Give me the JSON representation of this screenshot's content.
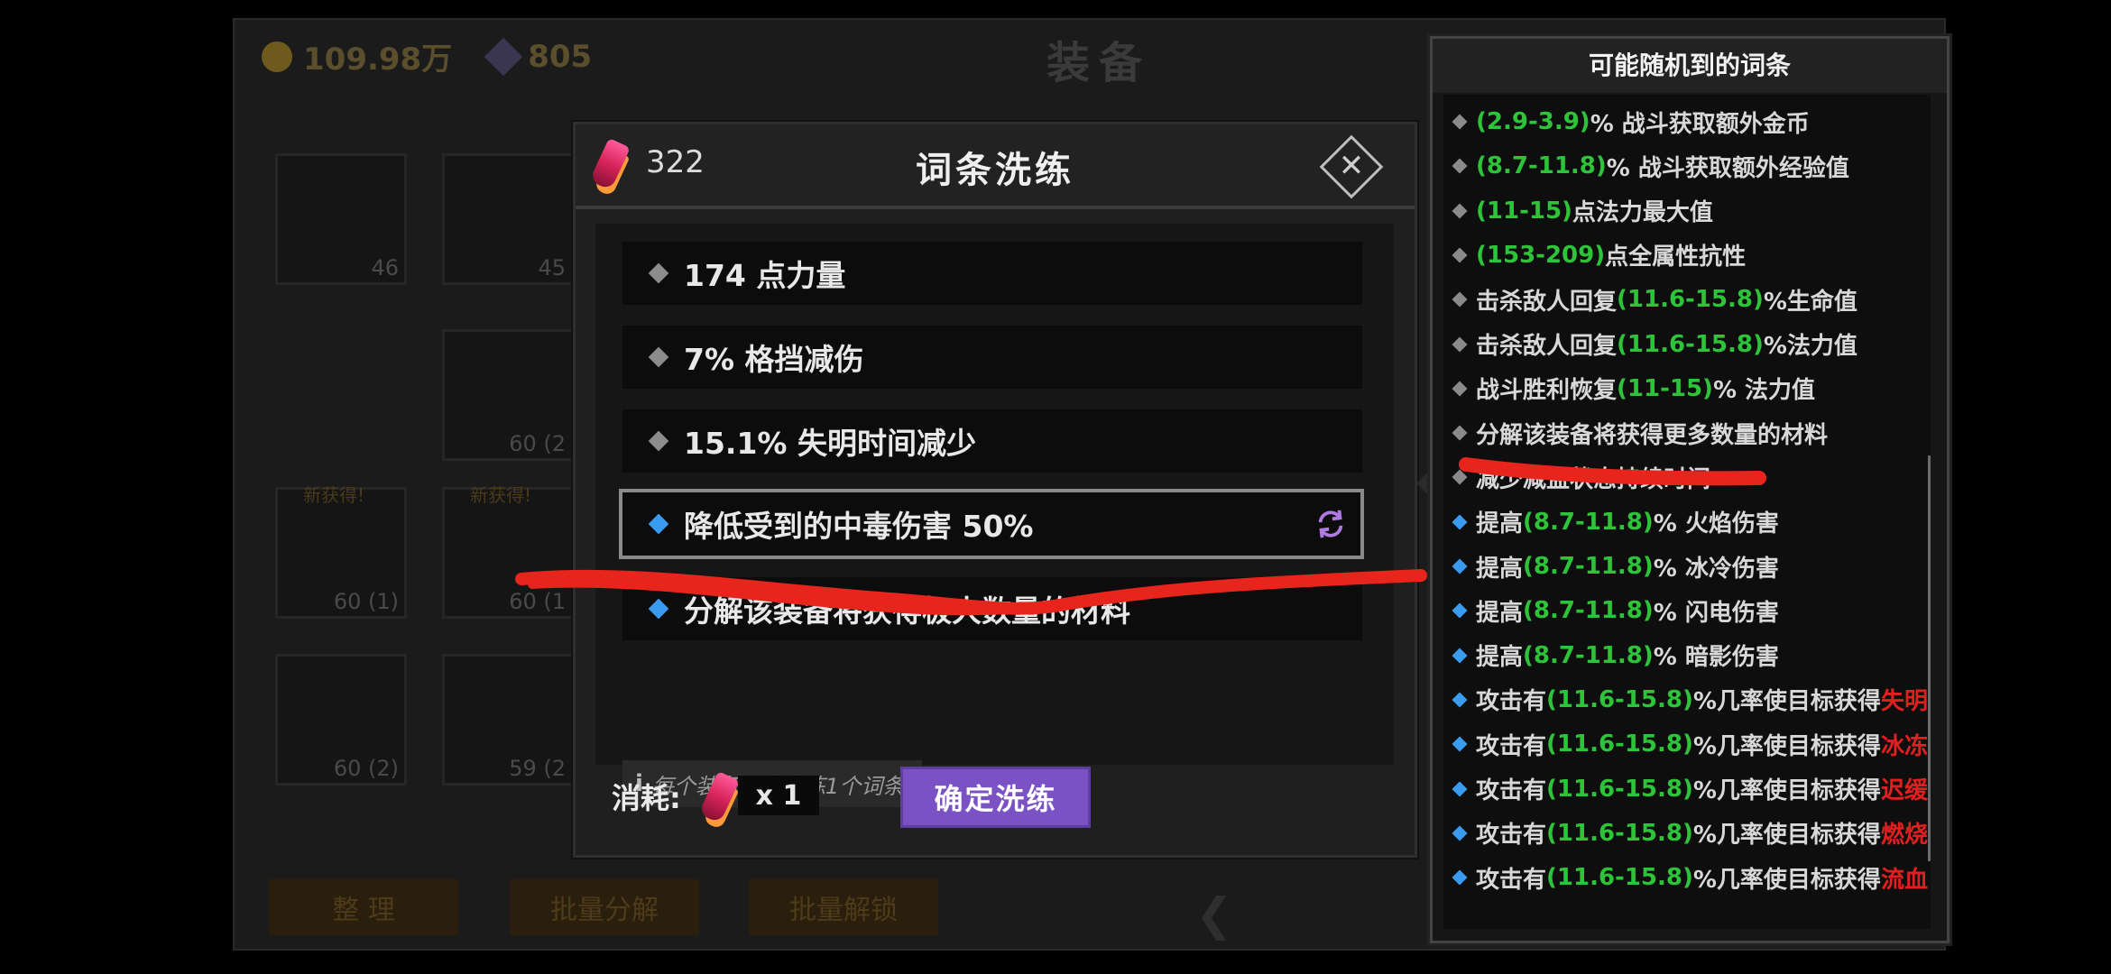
{
  "background": {
    "gold": "109.98万",
    "gems": "805",
    "title": "装备",
    "slots": [
      {
        "count": "46",
        "tag": ""
      },
      {
        "count": "45",
        "tag": ""
      },
      {
        "count": "60 (2",
        "tag": ""
      },
      {
        "count": "60 (1)",
        "tag": "新获得!"
      },
      {
        "count": "60 (1",
        "tag": "新获得!"
      },
      {
        "count": "60 (2)",
        "tag": ""
      },
      {
        "count": "59 (2",
        "tag": ""
      }
    ],
    "buttons": [
      "整 理",
      "批量分解",
      "批量解锁"
    ]
  },
  "dialog": {
    "crystal_count": "322",
    "title": "词条洗练",
    "affixes": [
      {
        "text": "174 点力量",
        "selected": false
      },
      {
        "text": "7% 格挡减伤",
        "selected": false
      },
      {
        "text": "15.1% 失明时间减少",
        "selected": false
      },
      {
        "text": "降低受到的中毒伤害 50%",
        "selected": true
      },
      {
        "text": "分解该装备将获得极大数量的材料",
        "selected": false
      }
    ],
    "note": "每个装备只能洗练1个词条",
    "note_icon": "i",
    "cost_label": "消耗:",
    "cost_amount": "x 1",
    "confirm_label": "确定洗练"
  },
  "pool": {
    "title": "可能随机到的词条",
    "rows": [
      {
        "parts": [
          {
            "t": "(2.9-3.9)",
            "c": "g"
          },
          {
            "t": "% 战斗获取额外金币",
            "c": ""
          }
        ],
        "blue": false
      },
      {
        "parts": [
          {
            "t": "(8.7-11.8)",
            "c": "g"
          },
          {
            "t": "% 战斗获取额外经验值",
            "c": ""
          }
        ],
        "blue": false
      },
      {
        "parts": [
          {
            "t": "(11-15)",
            "c": "g"
          },
          {
            "t": " 点法力最大值",
            "c": ""
          }
        ],
        "blue": false
      },
      {
        "parts": [
          {
            "t": "(153-209)",
            "c": "g"
          },
          {
            "t": " 点全属性抗性",
            "c": ""
          }
        ],
        "blue": false
      },
      {
        "parts": [
          {
            "t": "击杀敌人回复",
            "c": ""
          },
          {
            "t": "(11.6-15.8)",
            "c": "g"
          },
          {
            "t": "%生命值",
            "c": ""
          }
        ],
        "blue": false
      },
      {
        "parts": [
          {
            "t": "击杀敌人回复",
            "c": ""
          },
          {
            "t": "(11.6-15.8)",
            "c": "g"
          },
          {
            "t": "%法力值",
            "c": ""
          }
        ],
        "blue": false
      },
      {
        "parts": [
          {
            "t": "战斗胜利恢复",
            "c": ""
          },
          {
            "t": "(11-15)",
            "c": "g"
          },
          {
            "t": "% 法力值",
            "c": ""
          }
        ],
        "blue": false
      },
      {
        "parts": [
          {
            "t": "分解该装备将获得更多数量的材料",
            "c": ""
          }
        ],
        "blue": false
      },
      {
        "parts": [
          {
            "t": "减少减益状态持续时间",
            "c": ""
          }
        ],
        "blue": false
      },
      {
        "parts": [
          {
            "t": "提高",
            "c": ""
          },
          {
            "t": "(8.7-11.8)",
            "c": "g"
          },
          {
            "t": "% 火焰伤害",
            "c": ""
          }
        ],
        "blue": true
      },
      {
        "parts": [
          {
            "t": "提高",
            "c": ""
          },
          {
            "t": "(8.7-11.8)",
            "c": "g"
          },
          {
            "t": "% 冰冷伤害",
            "c": ""
          }
        ],
        "blue": true
      },
      {
        "parts": [
          {
            "t": "提高",
            "c": ""
          },
          {
            "t": "(8.7-11.8)",
            "c": "g"
          },
          {
            "t": "% 闪电伤害",
            "c": ""
          }
        ],
        "blue": true
      },
      {
        "parts": [
          {
            "t": "提高",
            "c": ""
          },
          {
            "t": "(8.7-11.8)",
            "c": "g"
          },
          {
            "t": "% 暗影伤害",
            "c": ""
          }
        ],
        "blue": true
      },
      {
        "parts": [
          {
            "t": "攻击有",
            "c": ""
          },
          {
            "t": "(11.6-15.8)",
            "c": "g"
          },
          {
            "t": "%几率使目标获得",
            "c": ""
          },
          {
            "t": "失明",
            "c": "r"
          }
        ],
        "blue": true
      },
      {
        "parts": [
          {
            "t": "攻击有",
            "c": ""
          },
          {
            "t": "(11.6-15.8)",
            "c": "g"
          },
          {
            "t": "%几率使目标获得",
            "c": ""
          },
          {
            "t": "冰冻",
            "c": "r"
          }
        ],
        "blue": true
      },
      {
        "parts": [
          {
            "t": "攻击有",
            "c": ""
          },
          {
            "t": "(11.6-15.8)",
            "c": "g"
          },
          {
            "t": "%几率使目标获得",
            "c": ""
          },
          {
            "t": "迟缓",
            "c": "r"
          }
        ],
        "blue": true
      },
      {
        "parts": [
          {
            "t": "攻击有",
            "c": ""
          },
          {
            "t": "(11.6-15.8)",
            "c": "g"
          },
          {
            "t": "%几率使目标获得",
            "c": ""
          },
          {
            "t": "燃烧",
            "c": "r"
          }
        ],
        "blue": true
      },
      {
        "parts": [
          {
            "t": "攻击有",
            "c": ""
          },
          {
            "t": "(11.6-15.8)",
            "c": "g"
          },
          {
            "t": "%几率使目标获得",
            "c": ""
          },
          {
            "t": "流血",
            "c": "r"
          }
        ],
        "blue": true
      }
    ]
  },
  "colors": {
    "range_green": "#2ec43a",
    "status_red": "#e02020",
    "accent_purple": "#7a52c4",
    "blue_diamond": "#3a9cf0",
    "scribble_red": "#e8251c"
  }
}
